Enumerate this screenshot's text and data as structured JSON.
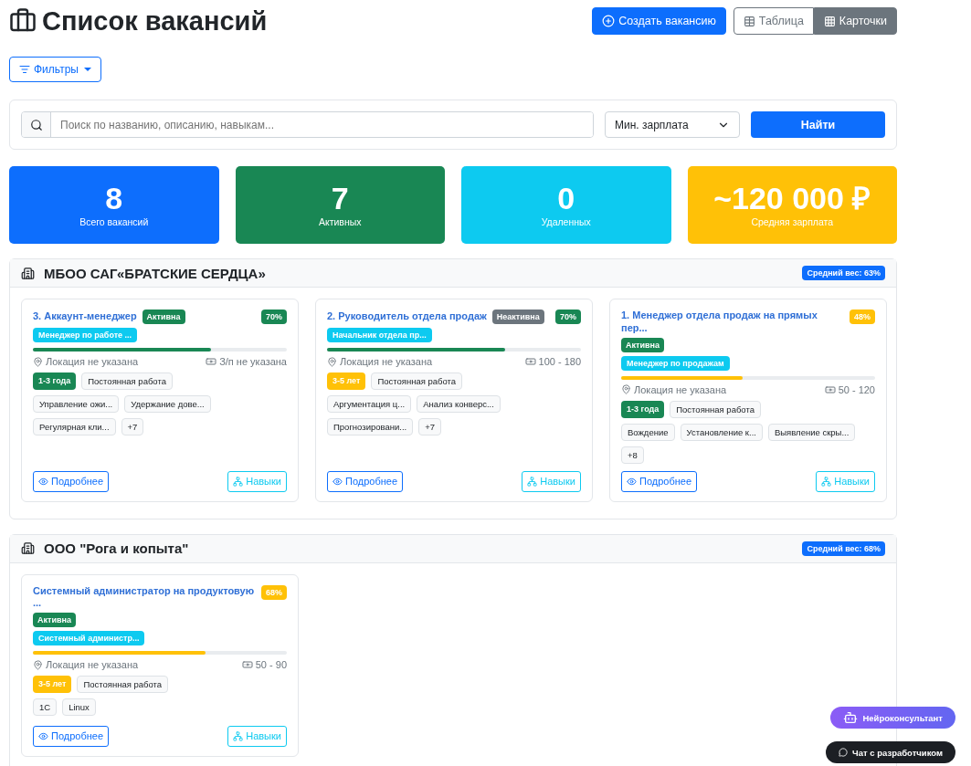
{
  "page": {
    "title": "Список вакансий"
  },
  "actions": {
    "create": "Создать вакансию",
    "views": [
      {
        "label": "Таблица",
        "kind": "table",
        "selected": false
      },
      {
        "label": "Карточки",
        "kind": "cards",
        "selected": true
      }
    ]
  },
  "filters_button": "Фильтры",
  "search": {
    "placeholder": "Поиск по названию, описанию, навыкам...",
    "salary_select": "Мин. зарплата",
    "submit": "Найти"
  },
  "stats": [
    {
      "value": "8",
      "label": "Всего вакансий",
      "color": "#0d6efd"
    },
    {
      "value": "7",
      "label": "Активных",
      "color": "#198754"
    },
    {
      "value": "0",
      "label": "Удаленных",
      "color": "#0dcaf0"
    },
    {
      "value": "~120 000 ₽",
      "label": "Средняя зарплата",
      "color": "#ffc107"
    }
  ],
  "groups": [
    {
      "company": "МБОО САГ«БРАТСКИЕ СЕРДЦА»",
      "weight": "Средний вес: 63%",
      "jobs": [
        {
          "title": "3. Аккаунт-менеджер",
          "status": {
            "label": "Активна",
            "active": true
          },
          "match": {
            "label": "70%",
            "color": "#198754"
          },
          "role": "Менеджер по работе ...",
          "level": 0.7,
          "location": "Локация не указана",
          "salary": "З/п не указана",
          "experience": {
            "label": "1-3 года",
            "color": "#198754"
          },
          "employment": "Постоянная работа",
          "skills": [
            "Управление ожи...",
            "Удержание дове...",
            "Регулярная кли..."
          ],
          "more": "+7",
          "details": "Подробнее",
          "skills_button": "Навыки"
        },
        {
          "title": "2. Руководитель отдела продаж",
          "status": {
            "label": "Неактивна",
            "active": false
          },
          "match": {
            "label": "70%",
            "color": "#198754"
          },
          "role": "Начальник отдела пр...",
          "level": 0.7,
          "location": "Локация не указана",
          "salary": "100 - 180",
          "experience": {
            "label": "3-5 лет",
            "color": "#ffc107"
          },
          "employment": "Постоянная работа",
          "skills": [
            "Аргументация ц...",
            "Анализ конверс...",
            "Прогнозировани..."
          ],
          "more": "+7",
          "details": "Подробнее",
          "skills_button": "Навыки"
        },
        {
          "title": "1. Менеджер отдела продаж на прямых пер...",
          "status": {
            "label": "Активна",
            "active": true
          },
          "match": {
            "label": "48%",
            "color": "#ffc107"
          },
          "role": "Менеджер по продажам",
          "level": 0.48,
          "location": "Локация не указана",
          "salary": "50 - 120",
          "experience": {
            "label": "1-3 года",
            "color": "#198754"
          },
          "employment": "Постоянная работа",
          "skills": [
            "Вождение",
            "Установление к...",
            "Выявление скры..."
          ],
          "more": "+8",
          "details": "Подробнее",
          "skills_button": "Навыки"
        }
      ]
    },
    {
      "company": "ООО \"Рога и копыта\"",
      "weight": "Средний вес: 68%",
      "jobs": [
        {
          "title": "Системный администратор на продуктовую ...",
          "status": {
            "label": "Активна",
            "active": true
          },
          "match": {
            "label": "68%",
            "color": "#ffc107"
          },
          "role": "Системный администр...",
          "level": 0.68,
          "location": "Локация не указана",
          "salary": "50 - 90",
          "experience": {
            "label": "3-5 лет",
            "color": "#ffc107"
          },
          "employment": "Постоянная работа",
          "skills": [
            "1C",
            "Linux"
          ],
          "details": "Подробнее",
          "skills_button": "Навыки"
        }
      ]
    }
  ],
  "floating": {
    "assistant": "Нейроконсультант",
    "chat": "Чат с разработчиком"
  }
}
